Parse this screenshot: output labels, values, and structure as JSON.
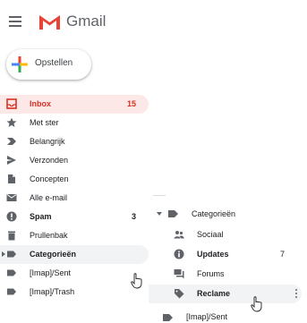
{
  "header": {
    "menu_icon": "hamburger-icon",
    "logo_icon": "gmail-m-logo",
    "app_name": "Gmail"
  },
  "compose": {
    "label": "Opstellen",
    "icon": "plus-icon"
  },
  "nav": {
    "items": [
      {
        "label": "Inbox",
        "count": "15",
        "icon": "inbox-icon"
      },
      {
        "label": "Met ster",
        "count": "",
        "icon": "star-icon"
      },
      {
        "label": "Belangrijk",
        "count": "",
        "icon": "important-icon"
      },
      {
        "label": "Verzonden",
        "count": "",
        "icon": "send-icon"
      },
      {
        "label": "Concepten",
        "count": "",
        "icon": "draft-icon"
      },
      {
        "label": "Alle e-mail",
        "count": "",
        "icon": "all-mail-icon"
      },
      {
        "label": "Spam",
        "count": "3",
        "icon": "spam-icon"
      },
      {
        "label": "Prullenbak",
        "count": "",
        "icon": "trash-icon"
      },
      {
        "label": "Categorieën",
        "count": "",
        "icon": "label-icon"
      },
      {
        "label": "[Imap]/Sent",
        "count": "",
        "icon": "label-icon"
      },
      {
        "label": "[Imap]/Trash",
        "count": "",
        "icon": "label-icon"
      }
    ]
  },
  "submenu": {
    "header": "Categorieën",
    "items": [
      {
        "label": "Sociaal",
        "count": "",
        "icon": "people-icon"
      },
      {
        "label": "Updates",
        "count": "7",
        "icon": "info-icon"
      },
      {
        "label": "Forums",
        "count": "",
        "icon": "forum-icon"
      },
      {
        "label": "Reclame",
        "count": "",
        "icon": "tag-icon"
      }
    ],
    "partial_item": "[Imap]/Sent"
  },
  "colors": {
    "accent_red": "#d93025",
    "active_bg": "#fce8e6",
    "hover_bg": "#f1f3f4",
    "icon_grey": "#5f6368"
  }
}
